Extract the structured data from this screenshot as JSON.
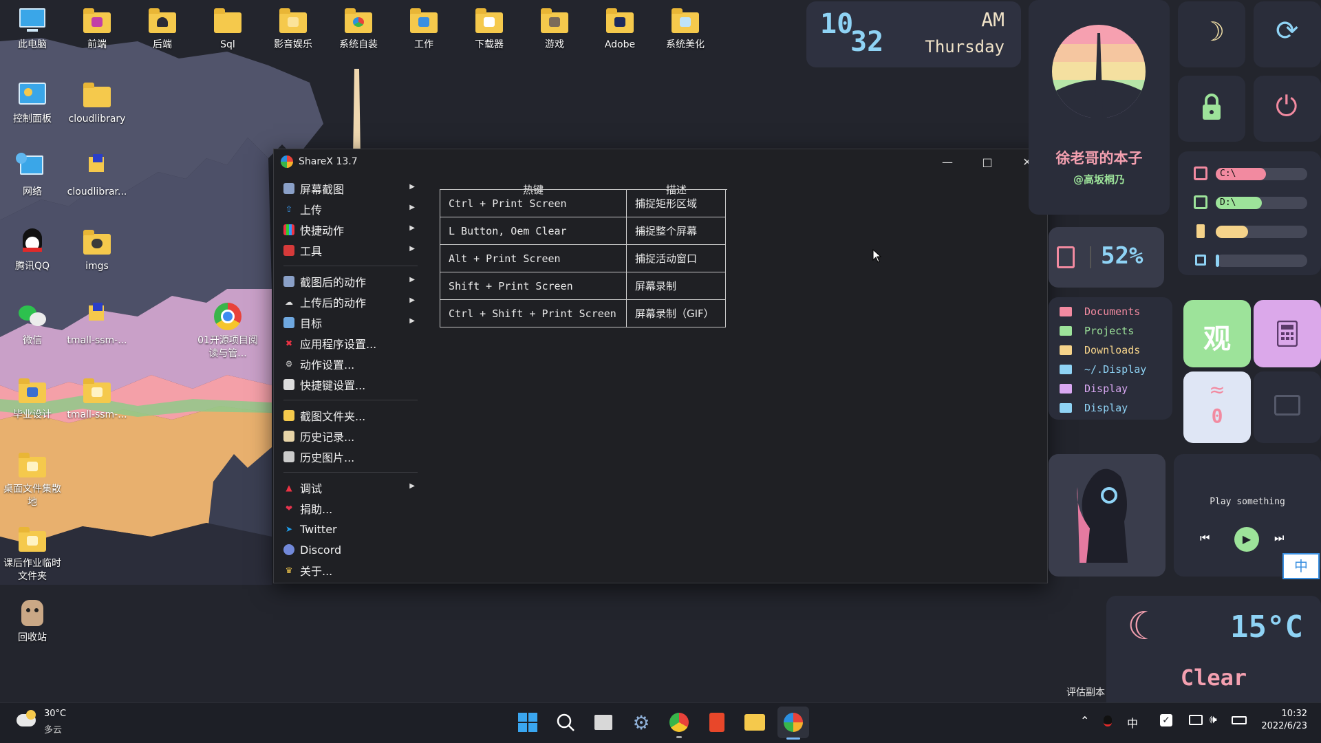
{
  "desktop": {
    "icons": [
      {
        "label": "此电脑",
        "icon": "computer-icon"
      },
      {
        "label": "前端",
        "icon": "folder-icon"
      },
      {
        "label": "后端",
        "icon": "folder-icon"
      },
      {
        "label": "Sql",
        "icon": "folder-icon"
      },
      {
        "label": "影音娱乐",
        "icon": "folder-icon"
      },
      {
        "label": "系统自装",
        "icon": "folder-icon"
      },
      {
        "label": "工作",
        "icon": "folder-icon"
      },
      {
        "label": "下载器",
        "icon": "folder-icon"
      },
      {
        "label": "游戏",
        "icon": "folder-icon"
      },
      {
        "label": "Adobe",
        "icon": "folder-icon"
      },
      {
        "label": "系统美化",
        "icon": "folder-icon"
      },
      {
        "label": "控制面板",
        "icon": "control-panel-icon"
      },
      {
        "label": "cloudlibrary",
        "icon": "folder-icon"
      },
      {
        "label": "网络",
        "icon": "network-icon"
      },
      {
        "label": "cloudlibrar...",
        "icon": "file-icon"
      },
      {
        "label": "腾讯QQ",
        "icon": "qq-icon"
      },
      {
        "label": "imgs",
        "icon": "folder-icon"
      },
      {
        "label": "微信",
        "icon": "wechat-icon"
      },
      {
        "label": "tmall-ssm-...",
        "icon": "file-icon"
      },
      {
        "label": "01开源项目阅读与管...",
        "icon": "chrome-icon"
      },
      {
        "label": "毕业设计",
        "icon": "folder-icon"
      },
      {
        "label": "tmall-ssm-...",
        "icon": "folder-icon"
      },
      {
        "label": "桌面文件集散地",
        "icon": "folder-icon"
      },
      {
        "label": "课后作业临时文件夹",
        "icon": "folder-icon"
      },
      {
        "label": "回收站",
        "icon": "recycle-bin-icon"
      }
    ],
    "watermark": "评估副本"
  },
  "window": {
    "title": "ShareX 13.7",
    "menu": [
      {
        "label": "屏幕截图",
        "icon": "screenshot-icon",
        "submenu": true
      },
      {
        "label": "上传",
        "icon": "upload-arrow-icon",
        "submenu": true
      },
      {
        "label": "快捷动作",
        "icon": "quick-actions-icon",
        "submenu": true
      },
      {
        "label": "工具",
        "icon": "toolbox-icon",
        "submenu": true
      },
      {
        "label": "截图后的动作",
        "icon": "after-capture-icon",
        "submenu": true
      },
      {
        "label": "上传后的动作",
        "icon": "cloud-upload-icon",
        "submenu": true
      },
      {
        "label": "目标",
        "icon": "destinations-icon",
        "submenu": true
      },
      {
        "label": "应用程序设置...",
        "icon": "wrench-icon",
        "submenu": false
      },
      {
        "label": "动作设置...",
        "icon": "gear-icon",
        "submenu": false
      },
      {
        "label": "快捷键设置...",
        "icon": "keyboard-icon",
        "submenu": false
      },
      {
        "label": "截图文件夹...",
        "icon": "folder-icon",
        "submenu": false
      },
      {
        "label": "历史记录...",
        "icon": "history-icon",
        "submenu": false
      },
      {
        "label": "历史图片...",
        "icon": "image-history-icon",
        "submenu": false
      },
      {
        "label": "调试",
        "icon": "debug-icon",
        "submenu": true
      },
      {
        "label": "捐助...",
        "icon": "heart-icon",
        "submenu": false
      },
      {
        "label": "Twitter",
        "icon": "twitter-icon",
        "submenu": false
      },
      {
        "label": "Discord",
        "icon": "discord-icon",
        "submenu": false
      },
      {
        "label": "关于...",
        "icon": "crown-icon",
        "submenu": false
      }
    ],
    "hotkeys": {
      "col_key": "热键",
      "col_desc": "描述",
      "rows": [
        {
          "key": "Ctrl + Print Screen",
          "desc": "捕捉矩形区域"
        },
        {
          "key": "L Button,  Oem Clear",
          "desc": "捕捉整个屏幕"
        },
        {
          "key": "Alt + Print Screen",
          "desc": "捕捉活动窗口"
        },
        {
          "key": "Shift + Print Screen",
          "desc": "屏幕录制"
        },
        {
          "key": "Ctrl + Shift + Print Screen",
          "desc": "屏幕录制（GIF）"
        }
      ]
    }
  },
  "widgets": {
    "clock": {
      "hour": "10",
      "minute": "32",
      "ampm": "AM",
      "day": "Thursday"
    },
    "profile": {
      "name": "徐老哥的本子",
      "subtitle": "@高坂桐乃"
    },
    "disks": [
      {
        "label": "C:\\",
        "level": 0.55,
        "color": "#f28aa0"
      },
      {
        "label": "D:\\",
        "level": 0.5,
        "color": "#9de39a"
      },
      {
        "label": "",
        "level": 0.35,
        "color": "#f5d38a"
      },
      {
        "label": "",
        "level": 0.02,
        "color": "#8fd3f5"
      }
    ],
    "cpu": {
      "percent": "52%"
    },
    "folders": [
      {
        "label": "Documents",
        "color": "#f28aa0"
      },
      {
        "label": "Projects",
        "color": "#9de39a"
      },
      {
        "label": "Downloads",
        "color": "#f5d38a"
      },
      {
        "label": "~/.Display",
        "color": "#8fd3f5"
      },
      {
        "label": "Display",
        "color": "#d9a8f2"
      },
      {
        "label": "Display",
        "color": "#8fd3f5"
      }
    ],
    "tile_text": "观",
    "wifi_count": "0",
    "media": {
      "status": "Play something"
    },
    "weather": {
      "temp": "15°C",
      "condition": "Clear"
    },
    "ime": "中"
  },
  "taskbar": {
    "weather_temp": "30°C",
    "weather_desc": "多云",
    "ime": "中",
    "time": "10:32",
    "date": "2022/6/23"
  }
}
